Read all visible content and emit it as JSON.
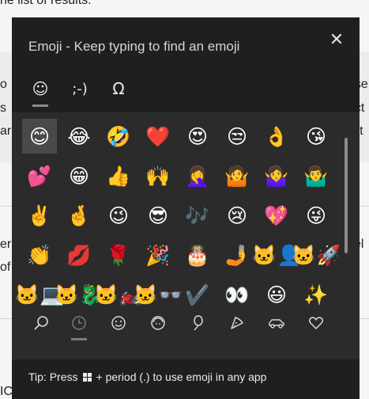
{
  "background": {
    "lines": [
      {
        "id": "bg-line-top",
        "text": "he list of results."
      },
      {
        "id": "bg-line-left-1",
        "text": "o"
      },
      {
        "id": "bg-line-right-1",
        "text": "use"
      },
      {
        "id": "bg-line-left-2",
        "text": "s"
      },
      {
        "id": "bg-line-right-2",
        "text": "ect"
      },
      {
        "id": "bg-line-left-3",
        "text": "ar"
      },
      {
        "id": "bg-line-right-3",
        "text": "list"
      },
      {
        "id": "bg-line-left-4",
        "text": "er"
      },
      {
        "id": "bg-line-right-4",
        "text": "sel"
      },
      {
        "id": "bg-line-left-5",
        "text": "of"
      },
      {
        "id": "bg-line-bottom",
        "text": "ICA"
      }
    ]
  },
  "panel": {
    "title": "Emoji - Keep typing to find an emoji",
    "close_label": "✕",
    "tabs": [
      {
        "name": "tab-emoji",
        "glyph": "☺",
        "selected": true
      },
      {
        "name": "tab-kaomoji",
        "glyph": ";-)",
        "selected": false
      },
      {
        "name": "tab-symbols",
        "glyph": "Ω",
        "selected": false
      }
    ],
    "emoji_rows": [
      [
        "😊",
        "😂",
        "🤣",
        "❤️",
        "😍",
        "😒",
        "👌",
        "😘"
      ],
      [
        "💕",
        "😁",
        "👍",
        "🙌",
        "🤦‍♀️",
        "🤷",
        "🤷‍♀️",
        "🤷‍♂️"
      ],
      [
        "✌️",
        "🤞",
        "😉",
        "😎",
        "🎶",
        "😢",
        "💖",
        "😜"
      ],
      [
        "👏",
        "💋",
        "🌹",
        "🎉",
        "🎂",
        "🤳",
        "🐱‍👤",
        "🐱‍🚀"
      ],
      [
        "🐱‍💻",
        "🐱‍🐉",
        "🐱‍🏍",
        "🐱‍👓",
        "✔️",
        "👀",
        "😃",
        "✨"
      ]
    ],
    "selected_emoji": "😊",
    "categories": [
      {
        "name": "search-icon",
        "label": "search"
      },
      {
        "name": "recent-clock-icon",
        "label": "recently used"
      },
      {
        "name": "smiley-face-icon",
        "label": "smiley faces and animals"
      },
      {
        "name": "people-icon",
        "label": "people"
      },
      {
        "name": "balloon-icon",
        "label": "celebrations and objects"
      },
      {
        "name": "pizza-icon",
        "label": "food and plants"
      },
      {
        "name": "car-icon",
        "label": "transportation and places"
      },
      {
        "name": "heart-icon",
        "label": "symbols"
      }
    ],
    "tip": {
      "prefix": "Tip: Press",
      "suffix": "+ period (.) to use emoji in any app"
    }
  }
}
